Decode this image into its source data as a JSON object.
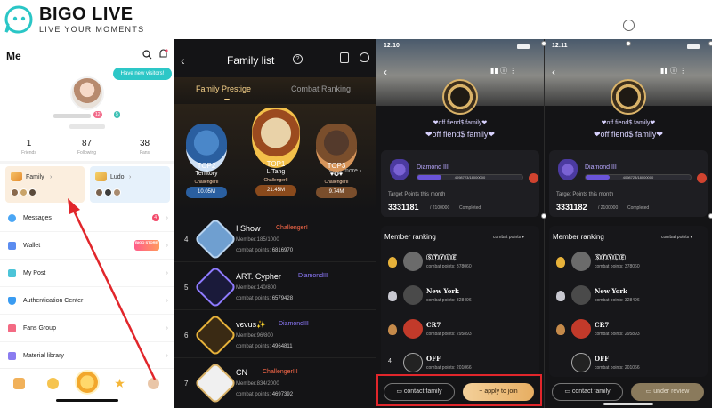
{
  "logo": {
    "title": "BIGO LIVE",
    "tagline": "LIVE YOUR MOMENTS"
  },
  "profile": {
    "header": "Me",
    "visitors_bubble": "Have new visitors!",
    "badge_a": "12",
    "badge_b": "5",
    "stats": [
      {
        "value": "1",
        "label": "Friends"
      },
      {
        "value": "87",
        "label": "Following"
      },
      {
        "value": "38",
        "label": "Fans"
      }
    ],
    "cards": {
      "family": "Family",
      "ludo": "Ludo"
    },
    "menu": [
      {
        "label": "Messages",
        "icon": "message-icon",
        "color": "#4aa6f5",
        "badge": "4"
      },
      {
        "label": "Wallet",
        "icon": "wallet-icon",
        "color": "#5b8cf0",
        "store": "BIGO STORE"
      },
      {
        "label": "My Post",
        "icon": "post-icon",
        "color": "#4cc4d8"
      },
      {
        "label": "Authentication Center",
        "icon": "shield-icon",
        "color": "#3a9cf2"
      },
      {
        "label": "Fans Group",
        "icon": "group-icon",
        "color": "#f36a83"
      },
      {
        "label": "Material library",
        "icon": "library-icon",
        "color": "#8a7cf0"
      }
    ]
  },
  "family_list": {
    "title": "Family list",
    "tabs": [
      "Family Prestige",
      "Combat Ranking"
    ],
    "view_more": "View more",
    "podium": [
      {
        "rank_label": "TOP2",
        "name": "Territory",
        "tier": "ChallengerII",
        "points": "10.05M"
      },
      {
        "rank_label": "TOP1",
        "name": "LiTang",
        "tier": "ChallengerII",
        "points": "21.45M"
      },
      {
        "rank_label": "TOP3",
        "name": "♥✪♥",
        "tier": "ChallengerII",
        "points": "9.74M"
      }
    ],
    "rows": [
      {
        "rank": "4",
        "name": "I Show",
        "tier": "ChallengerI",
        "tier_color": "#ff6b4a",
        "members": "Member:185/1000",
        "points_label": "combat points:",
        "points": "6816970"
      },
      {
        "rank": "5",
        "name": "ART. Cypher",
        "tier": "DiamondIII",
        "tier_color": "#8f7bff",
        "members": "Member:140/800",
        "points_label": "combat points:",
        "points": "6579428"
      },
      {
        "rank": "6",
        "name": "vєνus✨",
        "tier": "DiamondIII",
        "tier_color": "#8f7bff",
        "members": "Member:96/800",
        "points_label": "combat points:",
        "points": "4964811"
      },
      {
        "rank": "7",
        "name": "CN",
        "tier": "ChallengerIII",
        "tier_color": "#ff6b4a",
        "members": "Member:834/2000",
        "points_label": "combat points:",
        "points": "4697392"
      }
    ]
  },
  "family_detail": {
    "time_a": "12:10",
    "time_b": "12:11",
    "family_name": "❤off fiend$ family❤",
    "tier": "Diamond III",
    "progress_text": "4098723/18000000",
    "progress_fraction": 0.23,
    "target_label": "Target Points this month",
    "target_value_a": "3331181",
    "target_value_b": "3331182",
    "target_goal": "/ 2100000",
    "target_status": "Completed",
    "member_ranking": "Member ranking",
    "sort": "combat points",
    "members": [
      {
        "name": "ⓈⓉⓎⓁⒺ",
        "points_label": "combat points:",
        "points": "378060",
        "medal": "#e7b23a",
        "avatar": "#6b6b6b"
      },
      {
        "name": "New York",
        "points_label": "combat points:",
        "points": "328496",
        "medal": "#c8c8d0",
        "avatar": "#4a4a4a"
      },
      {
        "name": "CR7",
        "points_label": "combat points:",
        "points": "295893",
        "medal": "#c58a4a",
        "avatar": "#c23a2a"
      },
      {
        "name": "OFF",
        "points_label": "combat points:",
        "points": "201066",
        "medal": "",
        "avatar": "#222222"
      }
    ],
    "contact_button": "contact family",
    "apply_button": "+ apply to join",
    "review_button": "under review"
  }
}
